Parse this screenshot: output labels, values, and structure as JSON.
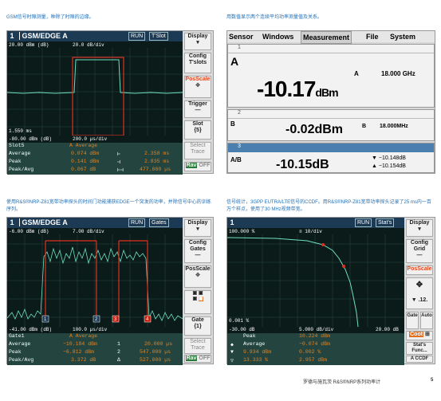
{
  "captions": {
    "tl": "GSM信号时隙测量，种除了时隙的边缘。",
    "tr": "用数值显示两个连续平均功率测量值及关系。",
    "bl": "使用R&S®NRP-Z81宽带功率探头的时间门功能捕获EDGE一个突发的功率，并除信号中心的训练序列。",
    "br": "信号统计，3GPP EUTRA/LTE信号的CCDF。用R&S®NRP-Z81宽带功率探头记录了25 ms内一百万个样点，使用了30 MHz视频带宽。"
  },
  "tl": {
    "num": "1",
    "title": "GSM/EDGE A",
    "tag1": "RUN",
    "tag2": "T'Slot",
    "top_left": "20.00 dBm (dB)",
    "top_mid": "20.0 dB/div",
    "ylow": "1.550 ms",
    "bot_left": "-80.00 dBm (dB)",
    "bot_mid": "200.0 µs/div",
    "stats": [
      {
        "label": "Slot5",
        "v1": "A Average",
        "v2": "",
        "v3": ""
      },
      {
        "label": "Average",
        "v1": "0.074 dBm",
        "v2": "⊢",
        "v3": "2.358 ms"
      },
      {
        "label": "Peak",
        "v1": "0.141 dBm",
        "v2": "⊣",
        "v3": "2.835 ms"
      },
      {
        "label": "Peak/Avg",
        "v1": "0.067 dB",
        "v2": "⊢⊣",
        "v3": "477.000 µs"
      }
    ],
    "side": {
      "display": "Display",
      "config": "Config T'slots",
      "posscale": "PosScale",
      "trigger": "Trigger",
      "slot": "Slot",
      "slotnum": "{5}",
      "select": "Select Trace",
      "rav": "Rav",
      "off": "OFF"
    }
  },
  "tr": {
    "menu": [
      "Sensor",
      "Windows",
      "Measurement",
      "File",
      "System"
    ],
    "w1": "1",
    "w1label": "A",
    "w1value": "-10.17",
    "w1unit": "dBm",
    "w1freqlabel": "A",
    "w1freq": "18.000 GHz",
    "w2": "2",
    "w2label": "B",
    "w2value": "-0.02dBm",
    "w2freqlabel": "B",
    "w2freq": "18.000MHz",
    "w3": "3",
    "w3label": "A/B",
    "w3value": "-10.15dB",
    "w3a": "−10.148dB",
    "w3b": "−10.154dB"
  },
  "bl": {
    "num": "1",
    "title": "GSM/EDGE A",
    "tag1": "RUN",
    "tag2": "Gates",
    "top_left": "-6.00 dBm (dB)",
    "top_mid": "7.00 dB/div",
    "bot_left": "-41.00 dBm (dB)",
    "bot_mid": "100.0 µs/div",
    "markers": [
      "1",
      "2",
      "3",
      "4"
    ],
    "stats": [
      {
        "label": "Gate1",
        "v1": "A Average",
        "v2": "",
        "v3": ""
      },
      {
        "label": "Average",
        "v1": "−10.184 dBm",
        "v2": "1",
        "v3": "20.000 µs"
      },
      {
        "label": "Peak",
        "v1": "−6.812 dBm",
        "v2": "2",
        "v3": "547.000 µs"
      },
      {
        "label": "Peak/Avg",
        "v1": "3.372 dB",
        "v2": "Δ",
        "v3": "527.000 µs"
      }
    ],
    "side": {
      "display": "Display",
      "config": "Config Gates",
      "posscale": "PosScale",
      "gate": "Gate",
      "gatenum": "{1}",
      "select": "Select Trace",
      "rav": "Rav",
      "off": "OFF"
    }
  },
  "br": {
    "num": "1",
    "tag1": "RUN",
    "tag2": "Stat's",
    "top_left": "100.000 %",
    "top_mid": "≡ 10/div",
    "ylow": "0.001 %",
    "bot_left": "-30.00 dB",
    "bot_mid": "5.000 dB/div",
    "bot_right": "20.00 dB",
    "stats": [
      {
        "label": "",
        "v1": "Peak",
        "v2": "10.224 dBm"
      },
      {
        "label": "◆",
        "v1": "Average",
        "v2": "−0.074 dBm"
      },
      {
        "label": "▼",
        "v1": "9.934 dBm",
        "v2": "0.002 %"
      },
      {
        "label": "▽",
        "v1": "13.333 %",
        "v2": "2.957 dBm"
      }
    ],
    "side": {
      "display": "Display",
      "config": "Config Grid",
      "posscale": "PosScale",
      "gate": "Gate",
      "auto": "Auto",
      "coot": "Coot",
      "stats": "Stat's Func...",
      "ccdf": "A CCDF"
    }
  },
  "footer": {
    "text": "罗德与施瓦茨 R&S®NRP系列功率计",
    "page": "5"
  }
}
